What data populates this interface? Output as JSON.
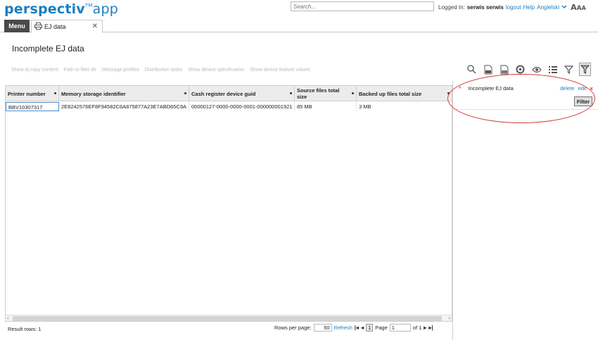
{
  "app": {
    "logo_main": "perspectiv",
    "logo_tm": "TM",
    "logo_suffix": "app"
  },
  "header": {
    "search_placeholder": "Search...",
    "logged_in_label": "Logged In:",
    "user": "serwis serwis",
    "logout": "logout",
    "help": "Help",
    "language": "Angielski",
    "font_size_label": "AAA"
  },
  "tabs": {
    "menu": "Menu",
    "active_tab": "EJ data"
  },
  "page": {
    "title": "Incomplete EJ data"
  },
  "actions": [
    "Show ej copy content",
    "Path to files dir",
    "Message profiles",
    "Distribution tasks",
    "Show device specification",
    "Show device feature values"
  ],
  "toolbar_icons": [
    "search-icon",
    "csv-export-icon",
    "pdf-export-icon",
    "refresh-settings-icon",
    "eye-icon",
    "columns-list-icon",
    "filter-icon",
    "filter-active-icon"
  ],
  "grid": {
    "columns": [
      "Printer number",
      "Memory storage identifier",
      "Cash register device guid",
      "Source files total size",
      "Backed up files total size"
    ],
    "rows": [
      [
        "BBV10307317",
        "2E8242576EF8F94582C6A875877A23E7ABD65C9A",
        "00000127-0000-0000-0001-000000001921",
        "85 MB",
        "3 MB"
      ]
    ]
  },
  "footer": {
    "result_rows": "Result rows: 1",
    "rows_per_page_label": "Rows per page:",
    "rows_per_page": "50",
    "refresh": "Refresh",
    "current_page_btn": "1",
    "page_label": "Page",
    "page_value": "1",
    "of_label": "of 1"
  },
  "filter_panel": {
    "collapse": "^",
    "filter_name": "Incomplete EJ data",
    "delete": "delete",
    "edit": "edit",
    "remove": "x",
    "filter_button": "Filter"
  },
  "colors": {
    "brand": "#1a7ec2",
    "annotation_oval": "#d23a3a"
  }
}
